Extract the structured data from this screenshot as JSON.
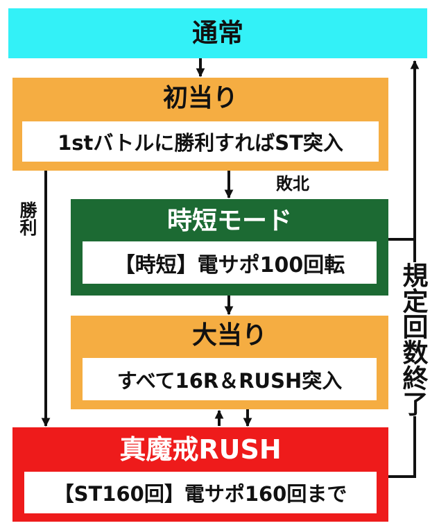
{
  "nodes": {
    "normal": {
      "title": "通常"
    },
    "first_hit": {
      "title": "初当り",
      "desc": "1stバトルに勝利すればST突入"
    },
    "jitan": {
      "title": "時短モード",
      "desc": "【時短】電サポ100回転"
    },
    "big_hit": {
      "title": "大当り",
      "desc": "すべて16R＆RUSH突入"
    },
    "rush": {
      "title": "真魔戒RUSH",
      "desc": "【ST160回】電サポ160回まで"
    }
  },
  "edge_labels": {
    "win": "勝利",
    "lose": "敗北",
    "limit_end": "規定回数終了"
  },
  "colors": {
    "normal": "#33f1f7",
    "orange": "#f5ad42",
    "green": "#1c6a33",
    "red": "#ee1b1b"
  }
}
